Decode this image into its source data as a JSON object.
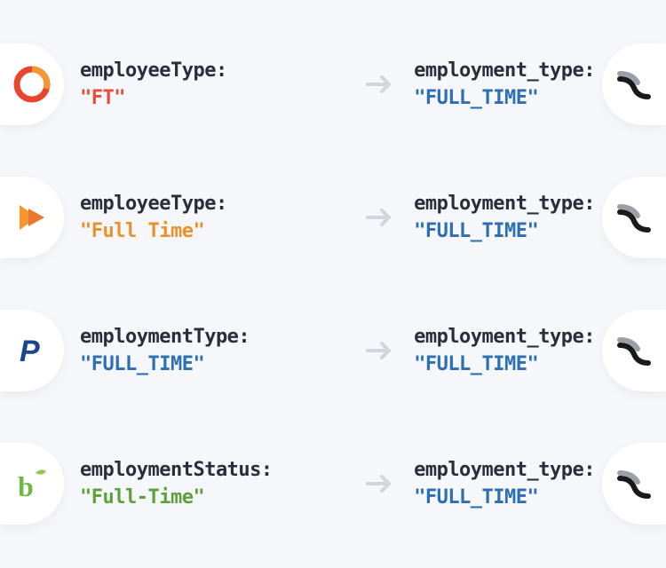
{
  "rows": [
    {
      "source_icon": "circle-logo",
      "source_key": "employeeType:",
      "source_value": "\"FT\"",
      "source_color": "value-red",
      "target_key": "employment_type:",
      "target_value": "\"FULL_TIME\"",
      "target_color": "value-blue",
      "target_icon": "merge-logo"
    },
    {
      "source_icon": "arrow-logo",
      "source_key": "employeeType:",
      "source_value": "\"Full Time\"",
      "source_color": "value-orange",
      "target_key": "employment_type:",
      "target_value": "\"FULL_TIME\"",
      "target_color": "value-blue",
      "target_icon": "merge-logo"
    },
    {
      "source_icon": "p-logo",
      "source_key": "employmentType:",
      "source_value": "\"FULL_TIME\"",
      "source_color": "value-blue",
      "target_key": "employment_type:",
      "target_value": "\"FULL_TIME\"",
      "target_color": "value-blue",
      "target_icon": "merge-logo"
    },
    {
      "source_icon": "bamboo-logo",
      "source_key": "employmentStatus:",
      "source_value": "\"Full-Time\"",
      "source_color": "value-green",
      "target_key": "employment_type:",
      "target_value": "\"FULL_TIME\"",
      "target_color": "value-blue",
      "target_icon": "merge-logo"
    }
  ]
}
